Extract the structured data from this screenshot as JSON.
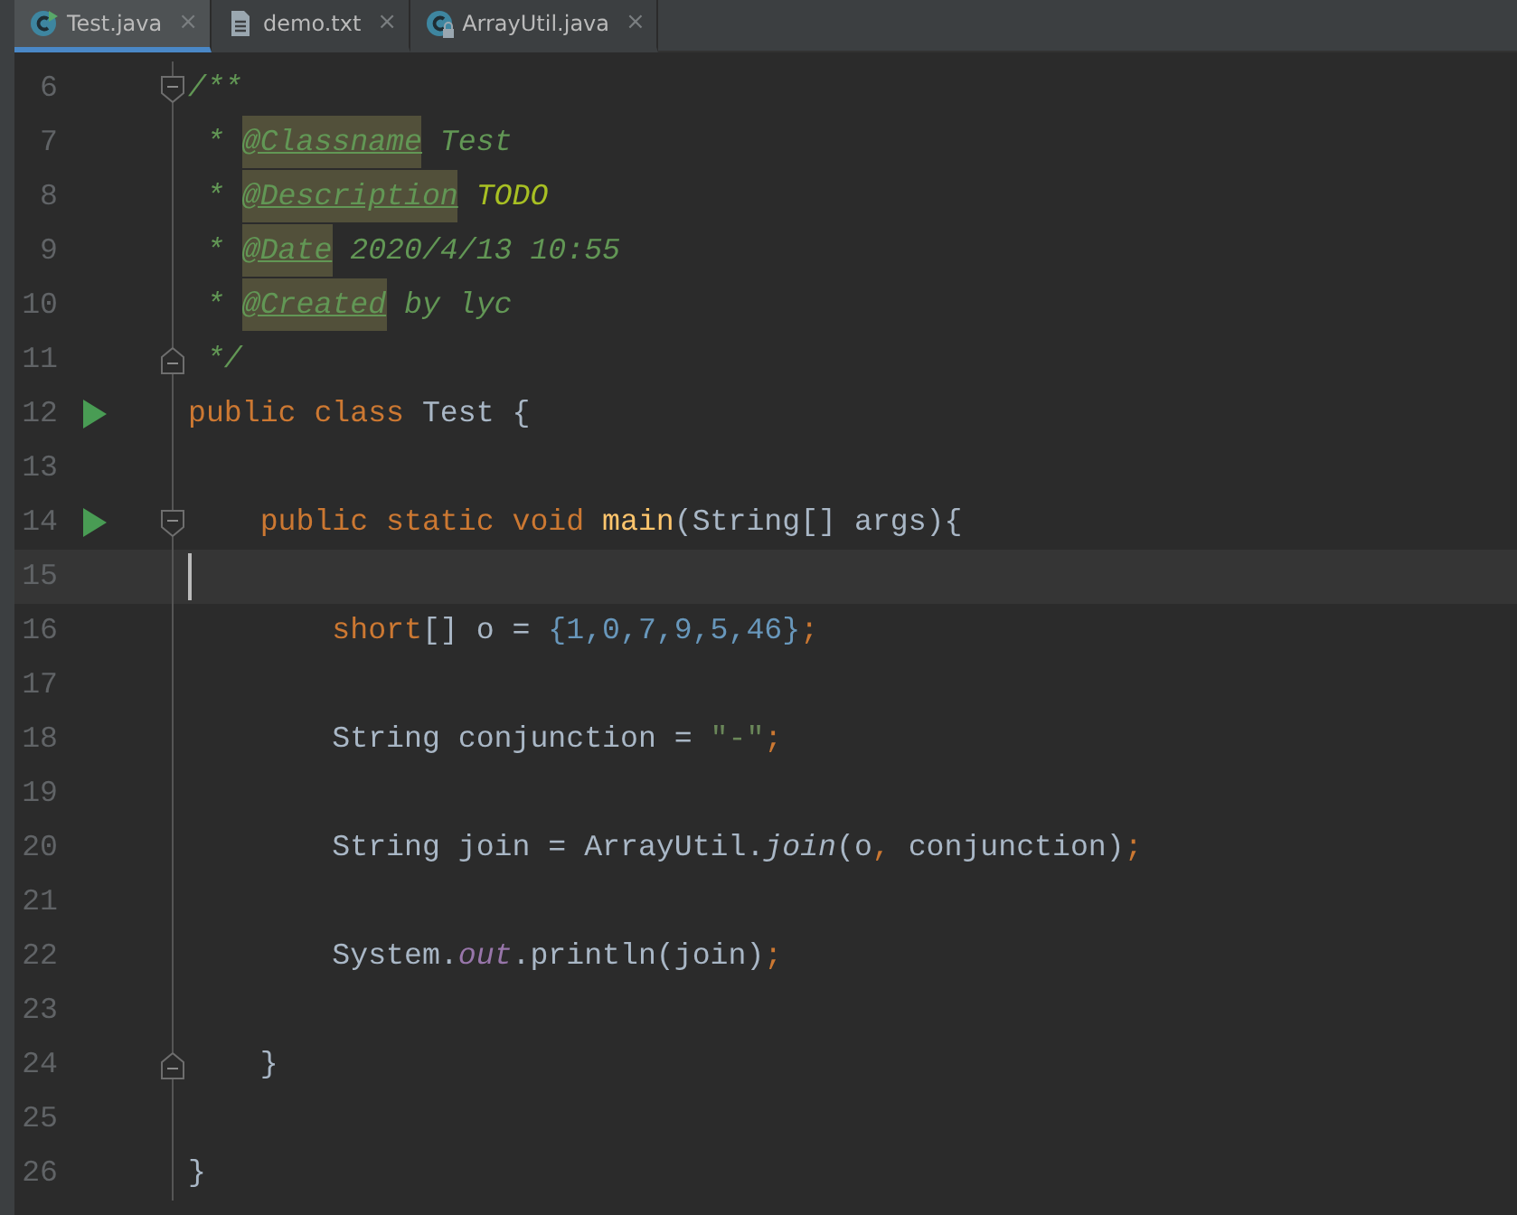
{
  "tabs": [
    {
      "label": "Test.java",
      "kind": "class",
      "selected": true,
      "close": "×"
    },
    {
      "label": "demo.txt",
      "kind": "text",
      "selected": false,
      "close": "×"
    },
    {
      "label": "ArrayUtil.java",
      "kind": "locked-class",
      "selected": false,
      "close": "×"
    }
  ],
  "lines": [
    {
      "number": "6",
      "run": false,
      "fold_start": true,
      "fold_end": false,
      "current": false,
      "tokens": [
        {
          "kind": "comment",
          "text": "/**"
        }
      ]
    },
    {
      "number": "7",
      "run": false,
      "fold_start": false,
      "fold_end": false,
      "current": false,
      "tokens": [
        {
          "kind": "comment",
          "text": " * "
        },
        {
          "kind": "doctag",
          "text": "@Classname"
        },
        {
          "kind": "comment",
          "text": " Test"
        }
      ]
    },
    {
      "number": "8",
      "run": false,
      "fold_start": false,
      "fold_end": false,
      "current": false,
      "tokens": [
        {
          "kind": "comment",
          "text": " * "
        },
        {
          "kind": "doctag",
          "text": "@Description"
        },
        {
          "kind": "todo",
          "text": " TODO"
        }
      ]
    },
    {
      "number": "9",
      "run": false,
      "fold_start": false,
      "fold_end": false,
      "current": false,
      "tokens": [
        {
          "kind": "comment",
          "text": " * "
        },
        {
          "kind": "doctag",
          "text": "@Date"
        },
        {
          "kind": "comment",
          "text": " 2020/4/13 10:55"
        }
      ]
    },
    {
      "number": "10",
      "run": false,
      "fold_start": false,
      "fold_end": false,
      "current": false,
      "tokens": [
        {
          "kind": "comment",
          "text": " * "
        },
        {
          "kind": "doctag",
          "text": "@Created"
        },
        {
          "kind": "comment",
          "text": " by lyc"
        }
      ]
    },
    {
      "number": "11",
      "run": false,
      "fold_start": false,
      "fold_end": true,
      "current": false,
      "tokens": [
        {
          "kind": "comment",
          "text": " */"
        }
      ]
    },
    {
      "number": "12",
      "run": true,
      "fold_start": false,
      "fold_end": false,
      "current": false,
      "tokens": [
        {
          "kind": "keyword",
          "text": "public class"
        },
        {
          "kind": "plain",
          "text": " Test {"
        }
      ]
    },
    {
      "number": "13",
      "run": false,
      "fold_start": false,
      "fold_end": false,
      "current": false
    },
    {
      "number": "14",
      "run": true,
      "fold_start": true,
      "fold_end": false,
      "current": false,
      "tokens": [
        {
          "kind": "keyword",
          "text": "    public static void "
        },
        {
          "kind": "declaration",
          "text": "main"
        },
        {
          "kind": "plain",
          "text": "(String[] args){"
        }
      ]
    },
    {
      "number": "15",
      "run": false,
      "fold_start": false,
      "fold_end": false,
      "current": true
    },
    {
      "number": "16",
      "run": false,
      "fold_start": false,
      "fold_end": false,
      "current": false,
      "tokens": [
        {
          "kind": "keyword",
          "text": "        short"
        },
        {
          "kind": "plain",
          "text": "[] o = "
        },
        {
          "kind": "number",
          "text": "{1,0,7,9,5,46}"
        },
        {
          "kind": "punct",
          "text": ";"
        }
      ]
    },
    {
      "number": "17",
      "run": false,
      "fold_start": false,
      "fold_end": false,
      "current": false
    },
    {
      "number": "18",
      "run": false,
      "fold_start": false,
      "fold_end": false,
      "current": false,
      "tokens": [
        {
          "kind": "plain",
          "text": "        String conjunction = "
        },
        {
          "kind": "string",
          "text": "\"-\""
        },
        {
          "kind": "punct",
          "text": ";"
        }
      ]
    },
    {
      "number": "19",
      "run": false,
      "fold_start": false,
      "fold_end": false,
      "current": false
    },
    {
      "number": "20",
      "run": false,
      "fold_start": false,
      "fold_end": false,
      "current": false,
      "tokens": [
        {
          "kind": "plain",
          "text": "        String join = ArrayUtil."
        },
        {
          "kind": "static-call",
          "text": "join"
        },
        {
          "kind": "plain",
          "text": "(o"
        },
        {
          "kind": "punct",
          "text": ","
        },
        {
          "kind": "plain",
          "text": " conjunction)"
        },
        {
          "kind": "punct",
          "text": ";"
        }
      ]
    },
    {
      "number": "21",
      "run": false,
      "fold_start": false,
      "fold_end": false,
      "current": false
    },
    {
      "number": "22",
      "run": false,
      "fold_start": false,
      "fold_end": false,
      "current": false,
      "tokens": [
        {
          "kind": "plain",
          "text": "        System."
        },
        {
          "kind": "field",
          "text": "out"
        },
        {
          "kind": "plain",
          "text": ".println(join)"
        },
        {
          "kind": "punct",
          "text": ";"
        }
      ]
    },
    {
      "number": "23",
      "run": false,
      "fold_start": false,
      "fold_end": false,
      "current": false
    },
    {
      "number": "24",
      "run": false,
      "fold_start": false,
      "fold_end": true,
      "current": false,
      "tokens": [
        {
          "kind": "plain",
          "text": "    }"
        }
      ]
    },
    {
      "number": "25",
      "run": false,
      "fold_start": false,
      "fold_end": false,
      "current": false
    },
    {
      "number": "26",
      "run": false,
      "fold_start": false,
      "fold_end": false,
      "current": false,
      "tokens": [
        {
          "kind": "plain",
          "text": "}"
        }
      ]
    }
  ]
}
